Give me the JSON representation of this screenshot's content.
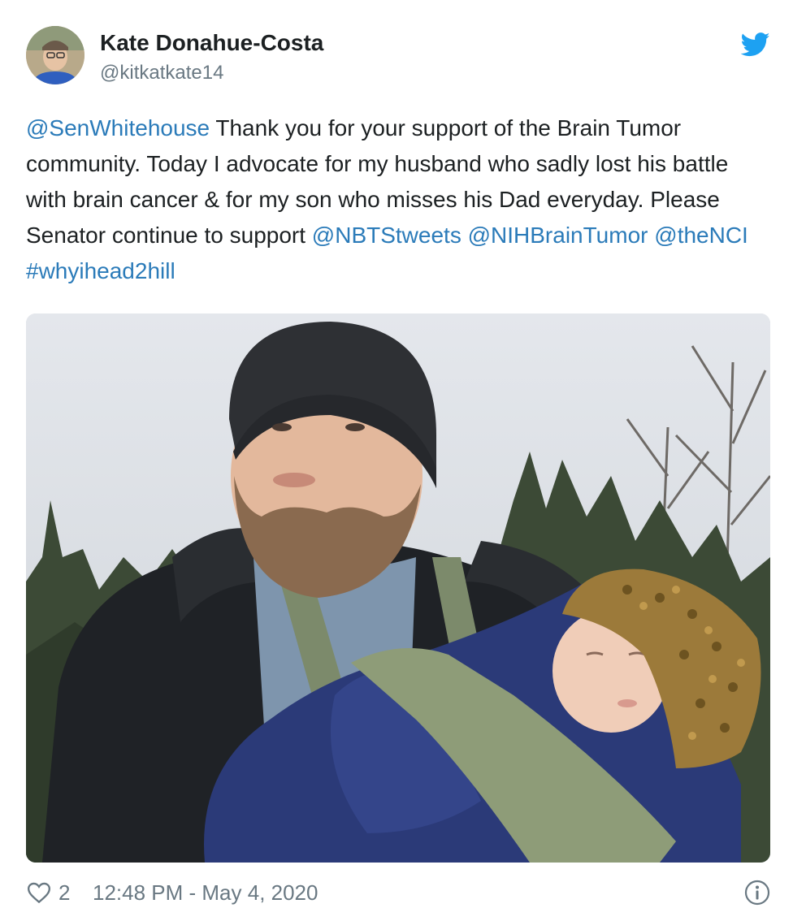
{
  "author": {
    "display_name": "Kate Donahue-Costa",
    "handle": "@kitkatkate14"
  },
  "tweet": {
    "segments": [
      {
        "text": "@SenWhitehouse",
        "link": true
      },
      {
        "text": " Thank you for your support of the Brain Tumor community. Today I advocate for my husband who sadly lost his battle with brain cancer & for my son who misses his Dad everyday.  Please Senator continue to support ",
        "link": false
      },
      {
        "text": "@NBTStweets",
        "link": true
      },
      {
        "text": " ",
        "link": false
      },
      {
        "text": "@NIHBrainTumor",
        "link": true
      },
      {
        "text": "  ",
        "link": false
      },
      {
        "text": "@theNCI",
        "link": true
      },
      {
        "text": " ",
        "link": false
      },
      {
        "text": "#whyihead2hill",
        "link": true
      }
    ]
  },
  "footer": {
    "like_count": "2",
    "timestamp": "12:48 PM - May 4, 2020"
  },
  "icons": {
    "brand": "twitter-bird-icon",
    "like": "heart-icon",
    "info": "info-icon"
  },
  "colors": {
    "link": "#2b7bb9",
    "brand": "#1da1f2",
    "muted": "#697882"
  }
}
